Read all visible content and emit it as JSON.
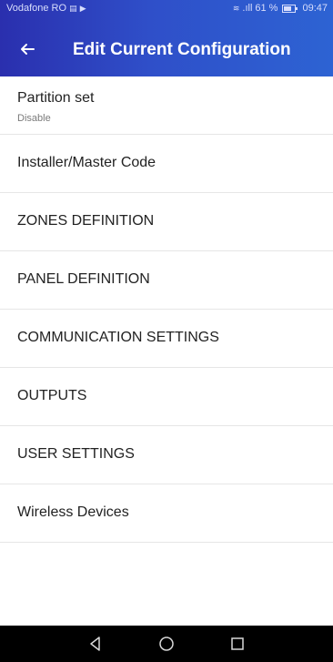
{
  "status_bar": {
    "carrier": "Vodafone RO",
    "signal_text": ".ıll",
    "battery_text": "61 %",
    "time": "09:47"
  },
  "app_bar": {
    "title": "Edit Current Configuration"
  },
  "items": [
    {
      "title": "Partition set",
      "subtitle": "Disable"
    },
    {
      "title": "Installer/Master Code"
    },
    {
      "title": "ZONES DEFINITION"
    },
    {
      "title": "PANEL DEFINITION"
    },
    {
      "title": "COMMUNICATION SETTINGS"
    },
    {
      "title": "OUTPUTS"
    },
    {
      "title": "USER SETTINGS"
    },
    {
      "title": "Wireless Devices"
    }
  ],
  "icons": {
    "back": "arrow-left-icon",
    "nav_back": "triangle-back-icon",
    "nav_home": "circle-home-icon",
    "nav_recents": "square-recents-icon"
  }
}
